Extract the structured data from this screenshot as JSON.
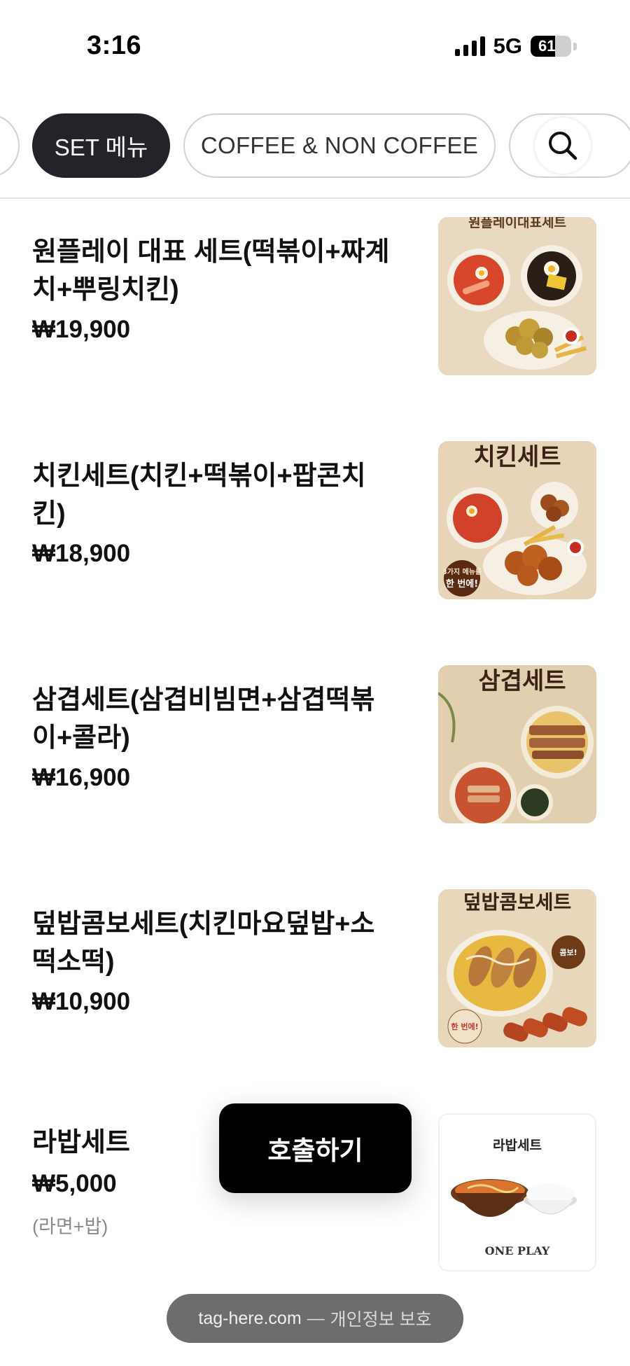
{
  "status_bar": {
    "time": "3:16",
    "network": "5G",
    "battery": "61",
    "battery_level": 0.61
  },
  "tabs": [
    {
      "label": ""
    },
    {
      "label": "SET 메뉴",
      "active": true
    },
    {
      "label": "COFFEE & NON COFFEE"
    }
  ],
  "search": {
    "icon": "search-icon"
  },
  "menu_items": [
    {
      "name": "원플레이 대표 세트(떡볶이+짜계치+뿌링치킨)",
      "price": "₩19,900",
      "description": "",
      "image_title": "원플레이대표세트"
    },
    {
      "name": "치킨세트(치킨+떡볶이+팝콘치킨)",
      "price": "₩18,900",
      "description": "",
      "image_title": "치킨세트"
    },
    {
      "name": "삼겹세트(삼겹비빔면+삼겹떡볶이+콜라)",
      "price": "₩16,900",
      "description": "",
      "image_title": "삼겹세트"
    },
    {
      "name": "덮밥콤보세트(치킨마요덮밥+소떡소떡)",
      "price": "₩10,900",
      "description": "",
      "image_title": "덮밥콤보세트"
    },
    {
      "name": "라밥세트",
      "price": "₩5,000",
      "description": "(라면+밥)",
      "image_title": "라밥세트",
      "image_brand": "ONE PLAY"
    }
  ],
  "call_button": {
    "label": "호출하기"
  },
  "footer": {
    "domain": "tag-here.com",
    "separator": "—",
    "privacy": "개인정보 보호"
  },
  "colors": {
    "active_tab_bg": "#222429",
    "call_button_bg": "#000000",
    "footer_bg": "#6d6d6d",
    "price_text": "#111111",
    "desc_text": "#8a8a8a"
  }
}
